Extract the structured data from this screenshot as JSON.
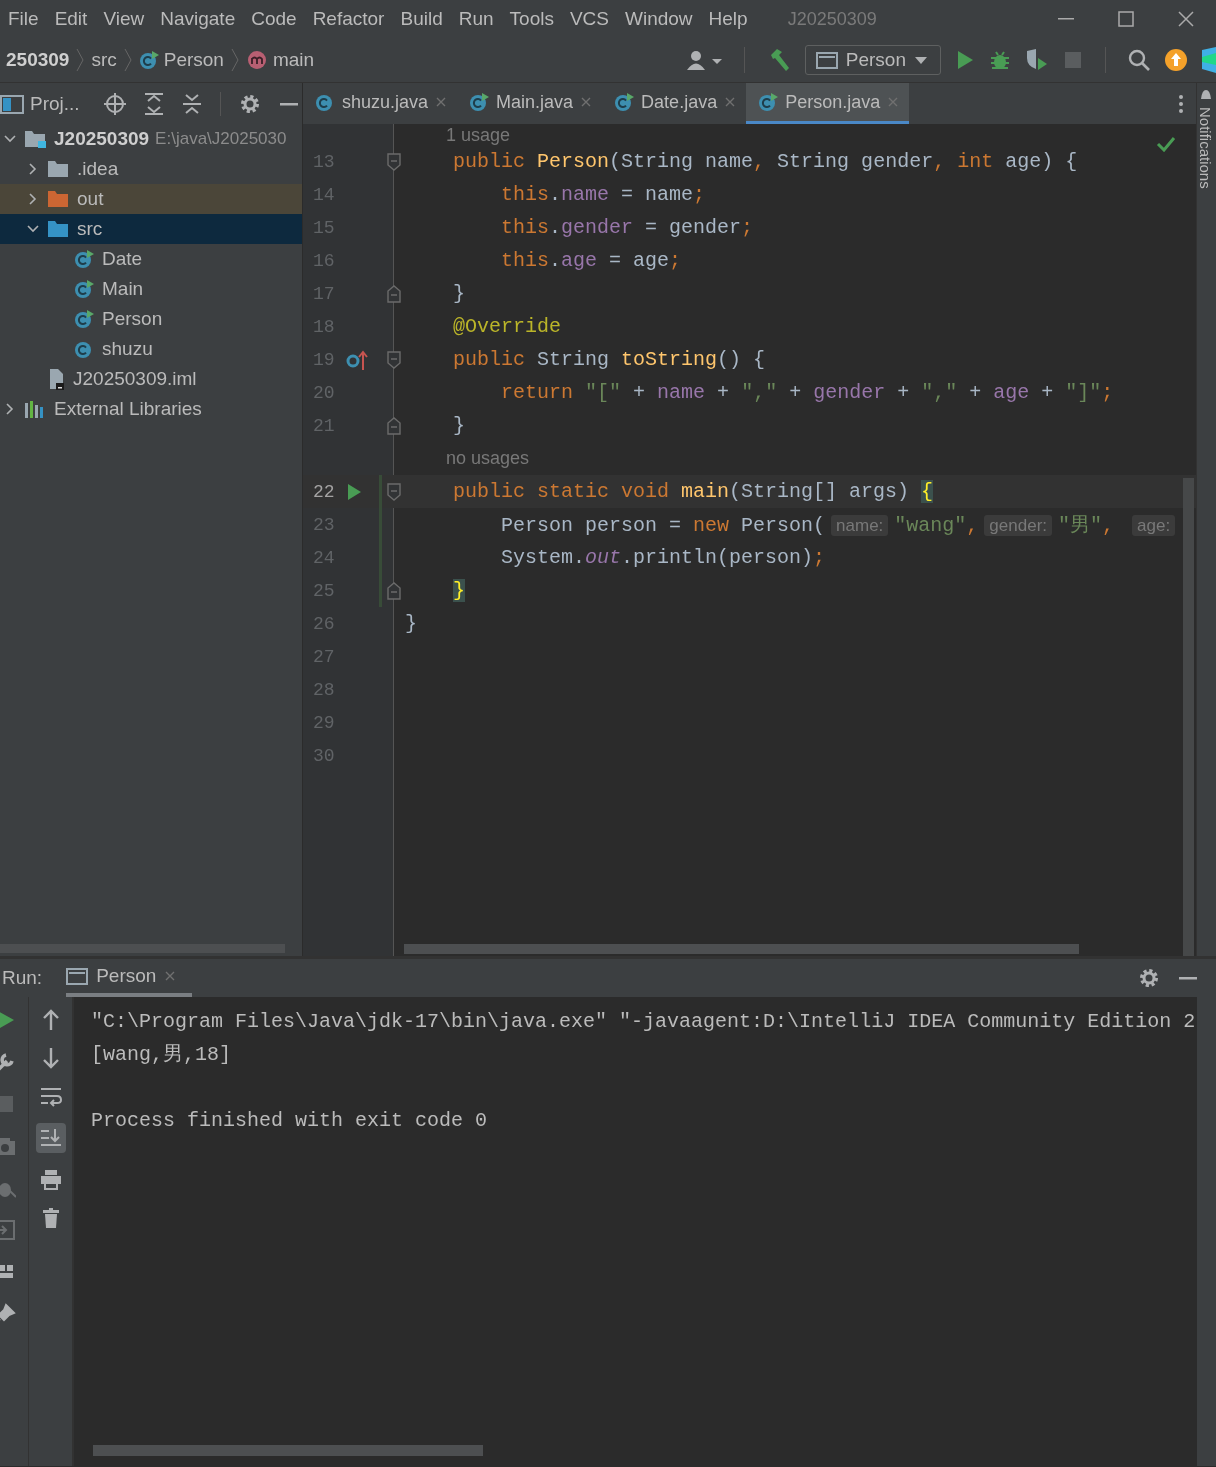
{
  "window": {
    "title": "J20250309"
  },
  "menu": [
    "File",
    "Edit",
    "View",
    "Navigate",
    "Code",
    "Refactor",
    "Build",
    "Run",
    "Tools",
    "VCS",
    "Window",
    "Help"
  ],
  "breadcrumbs": [
    {
      "label": "250309",
      "kind": "project"
    },
    {
      "label": "src",
      "kind": "folder"
    },
    {
      "label": "Person",
      "kind": "class"
    },
    {
      "label": "main",
      "kind": "method"
    }
  ],
  "run_config": {
    "label": "Person"
  },
  "project_panel": {
    "title": "Proj...",
    "tree": [
      {
        "label": "J20250309",
        "kind": "module",
        "path": "E:\\java\\J2025030",
        "expanded": true,
        "selected": false,
        "children": [
          {
            "label": ".idea",
            "kind": "folder",
            "expanded": false,
            "selected": false
          },
          {
            "label": "out",
            "kind": "excluded-folder",
            "expanded": false,
            "selected": false
          },
          {
            "label": "src",
            "kind": "source-folder",
            "expanded": true,
            "selected": true,
            "children": [
              {
                "label": "Date",
                "kind": "runnable-class",
                "selected": false
              },
              {
                "label": "Main",
                "kind": "runnable-class",
                "selected": false
              },
              {
                "label": "Person",
                "kind": "runnable-class",
                "selected": false
              },
              {
                "label": "shuzu",
                "kind": "class",
                "selected": false
              }
            ]
          },
          {
            "label": "J20250309.iml",
            "kind": "module-file",
            "selected": false
          }
        ]
      },
      {
        "label": "External Libraries",
        "kind": "library",
        "expanded": false,
        "selected": false
      }
    ]
  },
  "editor": {
    "tabs": [
      {
        "label": "shuzu.java",
        "kind": "class",
        "selected": false
      },
      {
        "label": "Main.java",
        "kind": "runnable-class",
        "selected": false
      },
      {
        "label": "Date.java",
        "kind": "runnable-class",
        "selected": false
      },
      {
        "label": "Person.java",
        "kind": "runnable-class",
        "selected": true
      }
    ],
    "lines": [
      {
        "kind": "usage",
        "text": "1 usage"
      },
      {
        "kind": "code",
        "number": "13",
        "current": false,
        "modified": false,
        "markers": [
          {
            "kind": "fold-start"
          }
        ],
        "tokens": [
          {
            "kind": "keyword",
            "text": "    public "
          },
          {
            "kind": "method",
            "text": "Person"
          },
          {
            "kind": "plain",
            "text": "(String name"
          },
          {
            "kind": "keyword",
            "text": ","
          },
          {
            "kind": "plain",
            "text": " String gender"
          },
          {
            "kind": "keyword",
            "text": ", int"
          },
          {
            "kind": "plain",
            "text": " age) {"
          }
        ]
      },
      {
        "kind": "code",
        "number": "14",
        "current": false,
        "modified": false,
        "tokens": [
          {
            "kind": "keyword",
            "text": "        this"
          },
          {
            "kind": "plain",
            "text": "."
          },
          {
            "kind": "field",
            "text": "name"
          },
          {
            "kind": "plain",
            "text": " = name"
          },
          {
            "kind": "keyword",
            "text": ";"
          }
        ]
      },
      {
        "kind": "code",
        "number": "15",
        "current": false,
        "modified": false,
        "tokens": [
          {
            "kind": "keyword",
            "text": "        this"
          },
          {
            "kind": "plain",
            "text": "."
          },
          {
            "kind": "field",
            "text": "gender"
          },
          {
            "kind": "plain",
            "text": " = gender"
          },
          {
            "kind": "keyword",
            "text": ";"
          }
        ]
      },
      {
        "kind": "code",
        "number": "16",
        "current": false,
        "modified": false,
        "tokens": [
          {
            "kind": "keyword",
            "text": "        this"
          },
          {
            "kind": "plain",
            "text": "."
          },
          {
            "kind": "field",
            "text": "age"
          },
          {
            "kind": "plain",
            "text": " = age"
          },
          {
            "kind": "keyword",
            "text": ";"
          }
        ]
      },
      {
        "kind": "code",
        "number": "17",
        "current": false,
        "modified": false,
        "markers": [
          {
            "kind": "fold-end"
          }
        ],
        "tokens": [
          {
            "kind": "plain",
            "text": "    }"
          }
        ]
      },
      {
        "kind": "code",
        "number": "18",
        "current": false,
        "modified": false,
        "tokens": [
          {
            "kind": "annotation",
            "text": "    @Override"
          }
        ]
      },
      {
        "kind": "code",
        "number": "19",
        "current": false,
        "modified": false,
        "markers": [
          {
            "kind": "override"
          },
          {
            "kind": "fold-start"
          }
        ],
        "tokens": [
          {
            "kind": "keyword",
            "text": "    public "
          },
          {
            "kind": "plain",
            "text": "String "
          },
          {
            "kind": "method",
            "text": "toString"
          },
          {
            "kind": "plain",
            "text": "() {"
          }
        ]
      },
      {
        "kind": "code",
        "number": "20",
        "current": false,
        "modified": false,
        "tokens": [
          {
            "kind": "keyword",
            "text": "        return "
          },
          {
            "kind": "string",
            "text": "\"[\""
          },
          {
            "kind": "plain",
            "text": " + "
          },
          {
            "kind": "field",
            "text": "name"
          },
          {
            "kind": "plain",
            "text": " + "
          },
          {
            "kind": "string",
            "text": "\",\""
          },
          {
            "kind": "plain",
            "text": " + "
          },
          {
            "kind": "field",
            "text": "gender"
          },
          {
            "kind": "plain",
            "text": " + "
          },
          {
            "kind": "string",
            "text": "\",\""
          },
          {
            "kind": "plain",
            "text": " + "
          },
          {
            "kind": "field",
            "text": "age"
          },
          {
            "kind": "plain",
            "text": " + "
          },
          {
            "kind": "string",
            "text": "\"]\""
          },
          {
            "kind": "keyword",
            "text": ";"
          }
        ]
      },
      {
        "kind": "code",
        "number": "21",
        "current": false,
        "modified": false,
        "markers": [
          {
            "kind": "fold-end"
          }
        ],
        "tokens": [
          {
            "kind": "plain",
            "text": "    }"
          }
        ]
      },
      {
        "kind": "usage",
        "text": "no usages"
      },
      {
        "kind": "code",
        "number": "22",
        "current": true,
        "modified": true,
        "markers": [
          {
            "kind": "run"
          },
          {
            "kind": "fold-start"
          }
        ],
        "tokens": [
          {
            "kind": "keyword",
            "text": "    public static void "
          },
          {
            "kind": "method",
            "text": "main"
          },
          {
            "kind": "plain",
            "text": "(String[] args) "
          },
          {
            "kind": "brace",
            "text": "{"
          }
        ]
      },
      {
        "kind": "code",
        "number": "23",
        "current": false,
        "modified": true,
        "tokens": [
          {
            "kind": "plain",
            "text": "        Person person = "
          },
          {
            "kind": "keyword",
            "text": "new "
          },
          {
            "kind": "plain",
            "text": "Person("
          },
          {
            "kind": "hint",
            "text": "name:"
          },
          {
            "kind": "string",
            "text": "\"wang\""
          },
          {
            "kind": "keyword",
            "text": ","
          },
          {
            "kind": "hint",
            "text": "gender:"
          },
          {
            "kind": "string",
            "text": "\"男\""
          },
          {
            "kind": "keyword",
            "text": ", "
          },
          {
            "kind": "hint",
            "text": "age:"
          }
        ]
      },
      {
        "kind": "code",
        "number": "24",
        "current": false,
        "modified": true,
        "tokens": [
          {
            "kind": "plain",
            "text": "        System."
          },
          {
            "kind": "static",
            "text": "out"
          },
          {
            "kind": "plain",
            "text": ".println(person)"
          },
          {
            "kind": "keyword",
            "text": ";"
          }
        ]
      },
      {
        "kind": "code",
        "number": "25",
        "current": false,
        "modified": true,
        "markers": [
          {
            "kind": "fold-end"
          }
        ],
        "tokens": [
          {
            "kind": "brace",
            "text": "    }"
          }
        ]
      },
      {
        "kind": "code",
        "number": "26",
        "current": false,
        "modified": false,
        "tokens": [
          {
            "kind": "plain",
            "text": "}"
          }
        ]
      },
      {
        "kind": "code",
        "number": "27",
        "current": false,
        "modified": false
      },
      {
        "kind": "code",
        "number": "28",
        "current": false,
        "modified": false
      },
      {
        "kind": "code",
        "number": "29",
        "current": false,
        "modified": false
      },
      {
        "kind": "code",
        "number": "30",
        "current": false,
        "modified": false
      }
    ]
  },
  "notifications": {
    "label": "Notifications"
  },
  "run_panel": {
    "title": "Run:",
    "tabs": [
      {
        "label": "Person",
        "selected": true
      }
    ],
    "console": [
      {
        "kind": "command",
        "text": "\"C:\\Program Files\\Java\\jdk-17\\bin\\java.exe\" \"-javaagent:D:\\IntelliJ IDEA Community Edition 2"
      },
      {
        "kind": "output",
        "text": "[wang,男,18]"
      },
      {
        "kind": "exit",
        "text": "Process finished with exit code 0"
      }
    ]
  }
}
